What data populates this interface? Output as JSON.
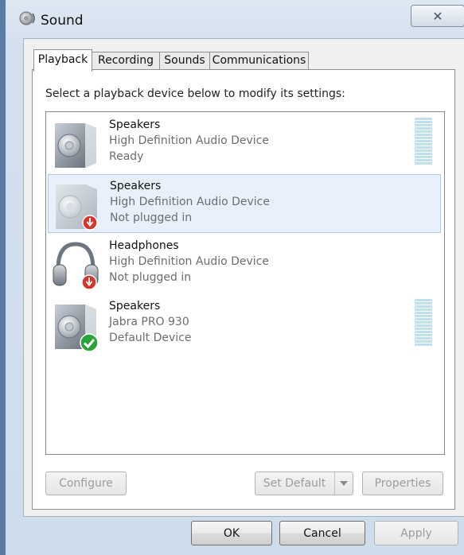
{
  "window": {
    "title": "Sound",
    "close_glyph": "✕"
  },
  "tabs": [
    {
      "label": "Playback",
      "active": true
    },
    {
      "label": "Recording",
      "active": false
    },
    {
      "label": "Sounds",
      "active": false
    },
    {
      "label": "Communications",
      "active": false
    }
  ],
  "playback": {
    "instruction": "Select a playback device below to modify its settings:",
    "devices": [
      {
        "name": "Speakers",
        "description": "High Definition Audio Device",
        "status": "Ready",
        "icon": "speaker-icon",
        "badge": "none",
        "selected": false,
        "level_meter": true
      },
      {
        "name": "Speakers",
        "description": "High Definition Audio Device",
        "status": "Not plugged in",
        "icon": "speaker-icon",
        "badge": "unplugged-badge-icon",
        "selected": true,
        "level_meter": false
      },
      {
        "name": "Headphones",
        "description": "High Definition Audio Device",
        "status": "Not plugged in",
        "icon": "headphones-icon",
        "badge": "unplugged-badge-icon",
        "selected": false,
        "level_meter": false
      },
      {
        "name": "Speakers",
        "description": "Jabra PRO 930",
        "status": "Default Device",
        "icon": "speaker-icon",
        "badge": "default-check-badge-icon",
        "selected": false,
        "level_meter": true
      }
    ],
    "buttons": {
      "configure": "Configure",
      "set_default": "Set Default",
      "properties": "Properties"
    }
  },
  "footer": {
    "ok": "OK",
    "cancel": "Cancel",
    "apply": "Apply"
  },
  "colors": {
    "meter": "#bfe3ee",
    "selected_row": "#e8f1fb",
    "unplugged_badge": "#d8342c",
    "default_badge": "#2aa33a"
  }
}
